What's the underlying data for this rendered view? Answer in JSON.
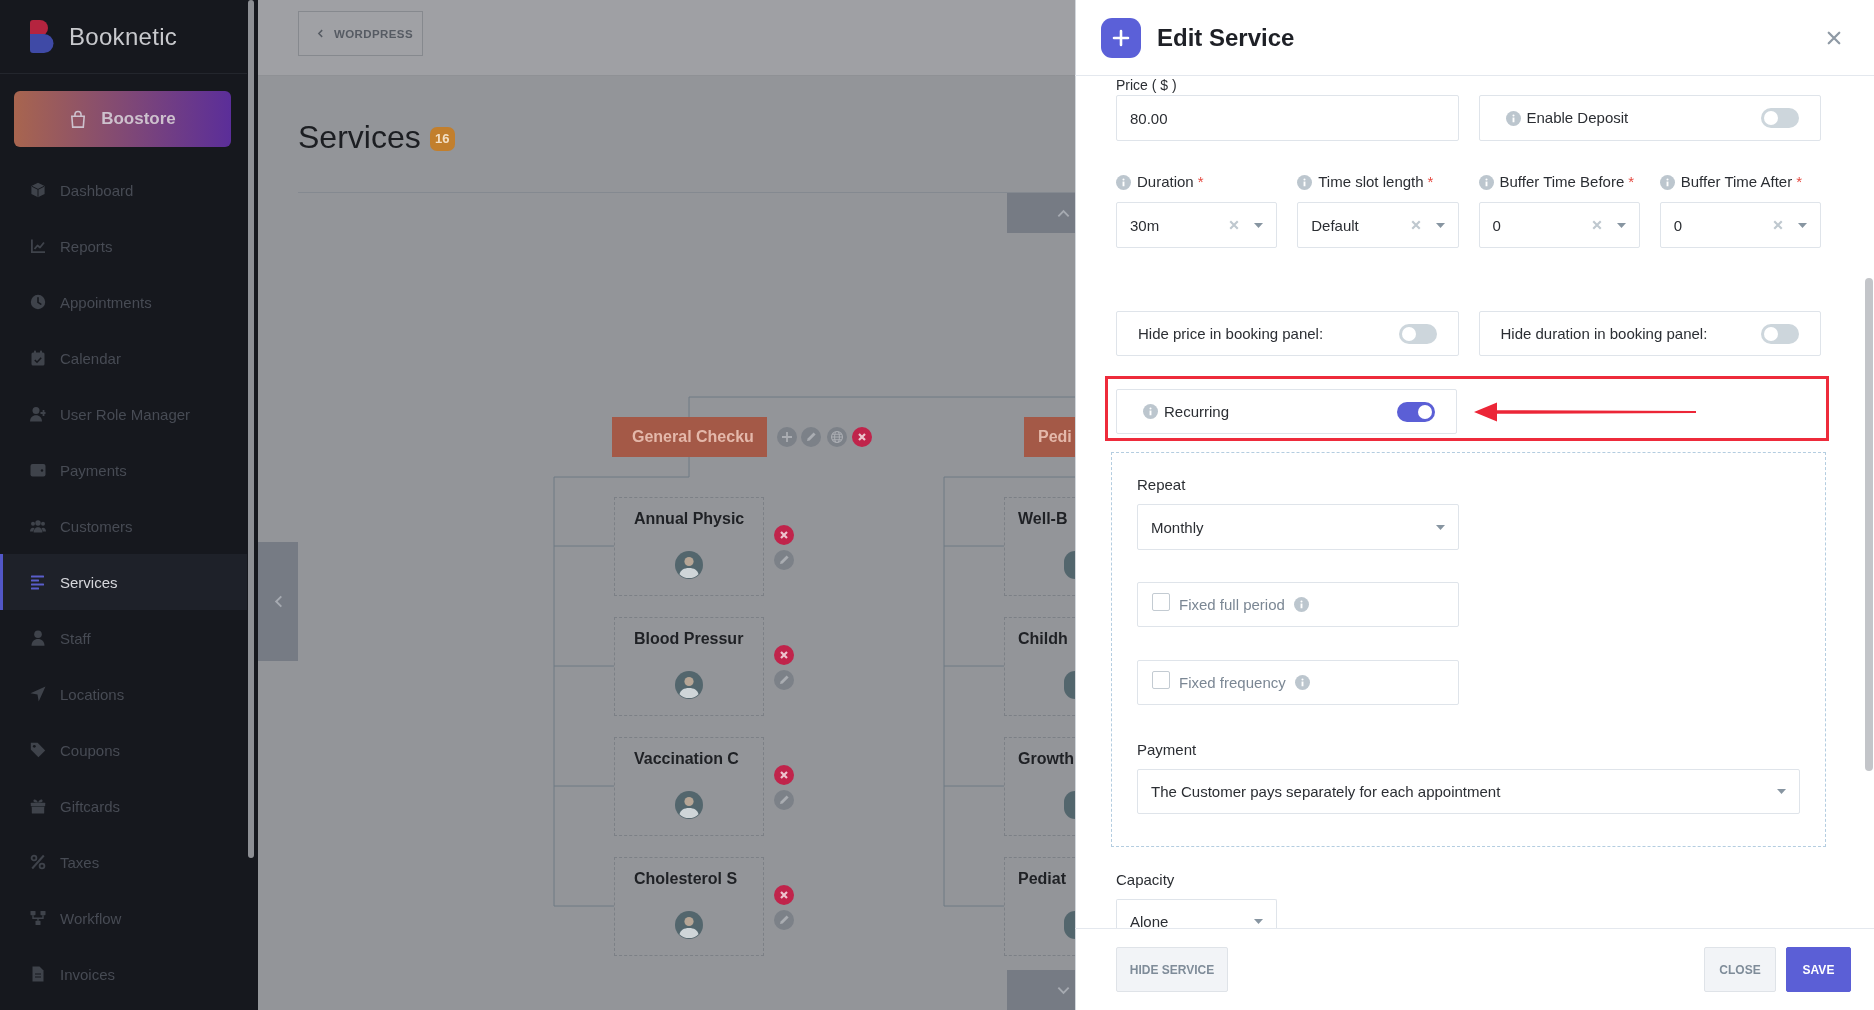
{
  "sidebar": {
    "brand": "Booknetic",
    "store_button": "Boostore",
    "items": [
      {
        "label": "Dashboard",
        "selected": false
      },
      {
        "label": "Reports",
        "selected": false
      },
      {
        "label": "Appointments",
        "selected": false
      },
      {
        "label": "Calendar",
        "selected": false
      },
      {
        "label": "User Role Manager",
        "selected": false
      },
      {
        "label": "Payments",
        "selected": false
      },
      {
        "label": "Customers",
        "selected": false
      },
      {
        "label": "Services",
        "selected": true
      },
      {
        "label": "Staff",
        "selected": false
      },
      {
        "label": "Locations",
        "selected": false
      },
      {
        "label": "Coupons",
        "selected": false
      },
      {
        "label": "Giftcards",
        "selected": false
      },
      {
        "label": "Taxes",
        "selected": false
      },
      {
        "label": "Workflow",
        "selected": false
      },
      {
        "label": "Invoices",
        "selected": false
      }
    ]
  },
  "topbar": {
    "back_button": "WORDPRESS"
  },
  "page": {
    "title": "Services",
    "count": "16"
  },
  "tree": {
    "categories": [
      {
        "name": "General Checku",
        "kind": "full",
        "services": [
          {
            "name": "Annual Physic"
          },
          {
            "name": "Blood Pressur"
          },
          {
            "name": "Vaccination C"
          },
          {
            "name": "Cholesterol S"
          }
        ]
      },
      {
        "name": "Pedi",
        "kind": "clipped",
        "services": [
          {
            "name": "Well-B"
          },
          {
            "name": "Childh"
          },
          {
            "name": "Growth"
          },
          {
            "name": "Pediat"
          }
        ]
      }
    ]
  },
  "panel": {
    "title": "Edit Service",
    "price": {
      "label": "Price ( $ )",
      "value": "80.00"
    },
    "deposit": {
      "label": "Enable Deposit",
      "on": false
    },
    "timing_fields": [
      {
        "label": "Duration",
        "mark": "*",
        "value": "30m"
      },
      {
        "label": "Time slot length",
        "mark": "*",
        "value": "Default"
      },
      {
        "label": "Buffer Time Before",
        "mark": "*",
        "value": "0"
      },
      {
        "label": "Buffer Time After",
        "mark": "*",
        "value": "0"
      }
    ],
    "visibility_toggles": [
      {
        "label": "Hide price in booking panel:",
        "on": false
      },
      {
        "label": "Hide duration in booking panel:",
        "on": false
      }
    ],
    "recurring": {
      "label": "Recurring",
      "on": true
    },
    "recurrence": {
      "repeat": {
        "label": "Repeat",
        "value": "Monthly"
      },
      "options": [
        {
          "label": "Fixed full period",
          "checked": false
        },
        {
          "label": "Fixed frequency",
          "checked": false
        }
      ],
      "payment": {
        "label": "Payment",
        "value": "The Customer pays separately for each appointment"
      }
    },
    "capacity": {
      "label": "Capacity",
      "value": "Alone"
    },
    "footer": {
      "hide_button": "HIDE SERVICE",
      "close_button": "CLOSE",
      "save_button": "SAVE"
    }
  }
}
